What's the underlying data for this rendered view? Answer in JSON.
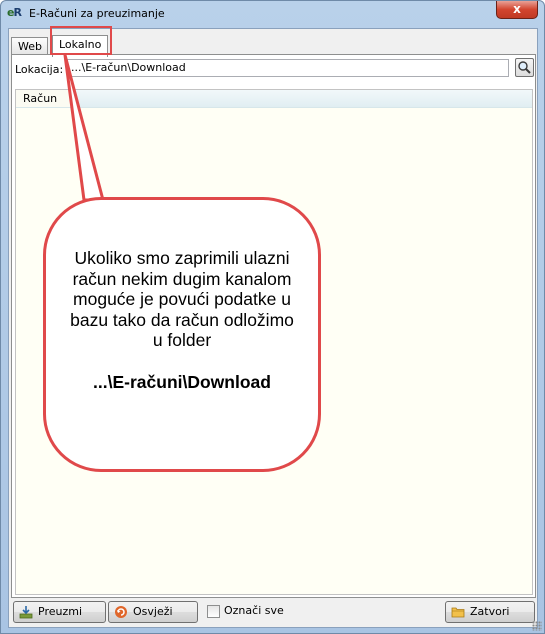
{
  "window": {
    "title": "E-Računi za preuzimanje",
    "logo_text": "eR",
    "close_label": "x"
  },
  "tabs": [
    {
      "label": "Web",
      "active": false
    },
    {
      "label": "Lokalno",
      "active": true
    }
  ],
  "location": {
    "label": "Lokacija:",
    "value": "...\\E-račun\\Download",
    "browse_icon": "search-icon"
  },
  "grid": {
    "columns": [
      "Račun"
    ],
    "rows": []
  },
  "callout": {
    "text": "Ukoliko smo zaprimili ulazni račun nekim dugim kanalom moguće je povući podatke  u bazu tako da račun  odložimo u folder",
    "path": "...\\E-računi\\Download",
    "border_color": "#e0494a"
  },
  "footer": {
    "preuzmi_label": "Preuzmi",
    "osvjezi_label": "Osvježi",
    "select_all_label": "Označi sve",
    "select_all_checked": false,
    "zatvori_label": "Zatvori"
  },
  "colors": {
    "accent_red": "#e0494a",
    "titlebar": "#b9d1ea",
    "close": "#d2452f"
  }
}
